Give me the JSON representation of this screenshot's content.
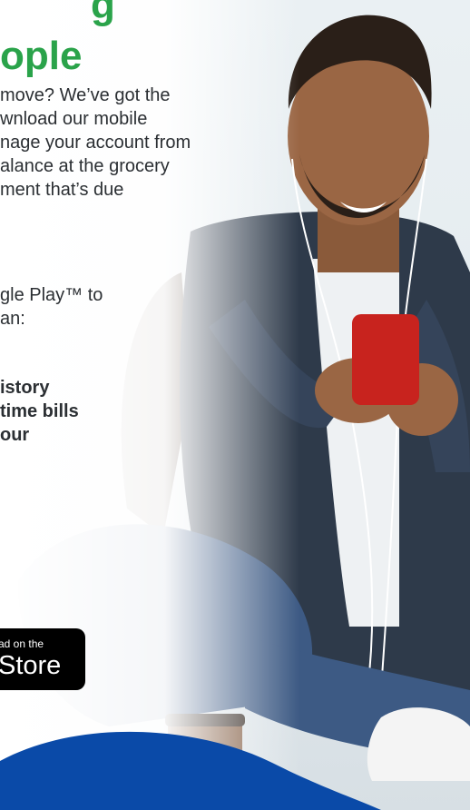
{
  "headline": {
    "line1": "g",
    "line2": "ople"
  },
  "paragraph1": {
    "lines": [
      "move? We’ve got the",
      "wnload our mobile",
      "nage your account from",
      "alance at the grocery",
      "ment that’s due"
    ]
  },
  "paragraph2": {
    "lines": [
      "gle Play™ to",
      "an:"
    ]
  },
  "bullets": [
    "istory",
    "time bills",
    "our"
  ],
  "app_store_badge": {
    "small": "ad on the",
    "big": "Store"
  },
  "colors": {
    "headline": "#2aa34a",
    "text": "#2b2f33",
    "wave_blue": "#0a4aa8",
    "badge": "#000000"
  }
}
